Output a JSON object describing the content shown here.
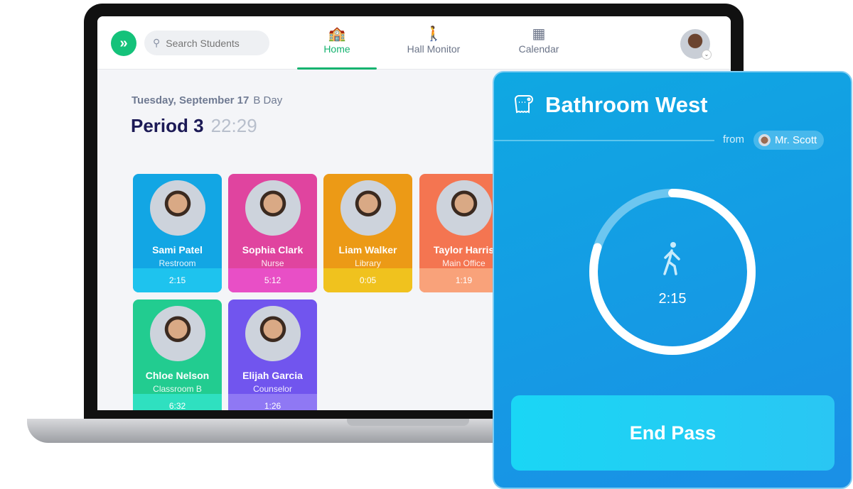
{
  "header": {
    "search_placeholder": "Search Students",
    "nav": [
      {
        "label": "Home",
        "icon": "school-icon",
        "active": true
      },
      {
        "label": "Hall Monitor",
        "icon": "walking-people-icon"
      },
      {
        "label": "Calendar",
        "icon": "calendar-icon"
      }
    ]
  },
  "schedule": {
    "date": "Tuesday, September 17",
    "day_type": "B Day",
    "period": "Period 3",
    "time_left": "22:29"
  },
  "students": [
    {
      "name": "Sami Patel",
      "location": "Restroom",
      "time": "2:15",
      "color": "#12a6e4",
      "footer": "#1ec3ee"
    },
    {
      "name": "Sophia Clark",
      "location": "Nurse",
      "time": "5:12",
      "color": "#e0449f",
      "footer": "#e84fc6"
    },
    {
      "name": "Liam Walker",
      "location": "Library",
      "time": "0:05",
      "color": "#ec9a16",
      "footer": "#f0c21e"
    },
    {
      "name": "Taylor Harris",
      "location": "Main Office",
      "time": "1:19",
      "color": "#f47551",
      "footer": "#f9a27a"
    },
    {
      "name": "Chloe Nelson",
      "location": "Classroom B",
      "time": "6:32",
      "color": "#22cc90",
      "footer": "#2fe0c0"
    },
    {
      "name": "Elijah Garcia",
      "location": "Counselor",
      "time": "1:26",
      "color": "#7155ee",
      "footer": "#8f78f4"
    }
  ],
  "pass": {
    "destination": "Bathroom West",
    "from_label": "from",
    "teacher": "Mr. Scott",
    "elapsed": "2:15",
    "progress": 0.8,
    "end_button": "End Pass"
  }
}
